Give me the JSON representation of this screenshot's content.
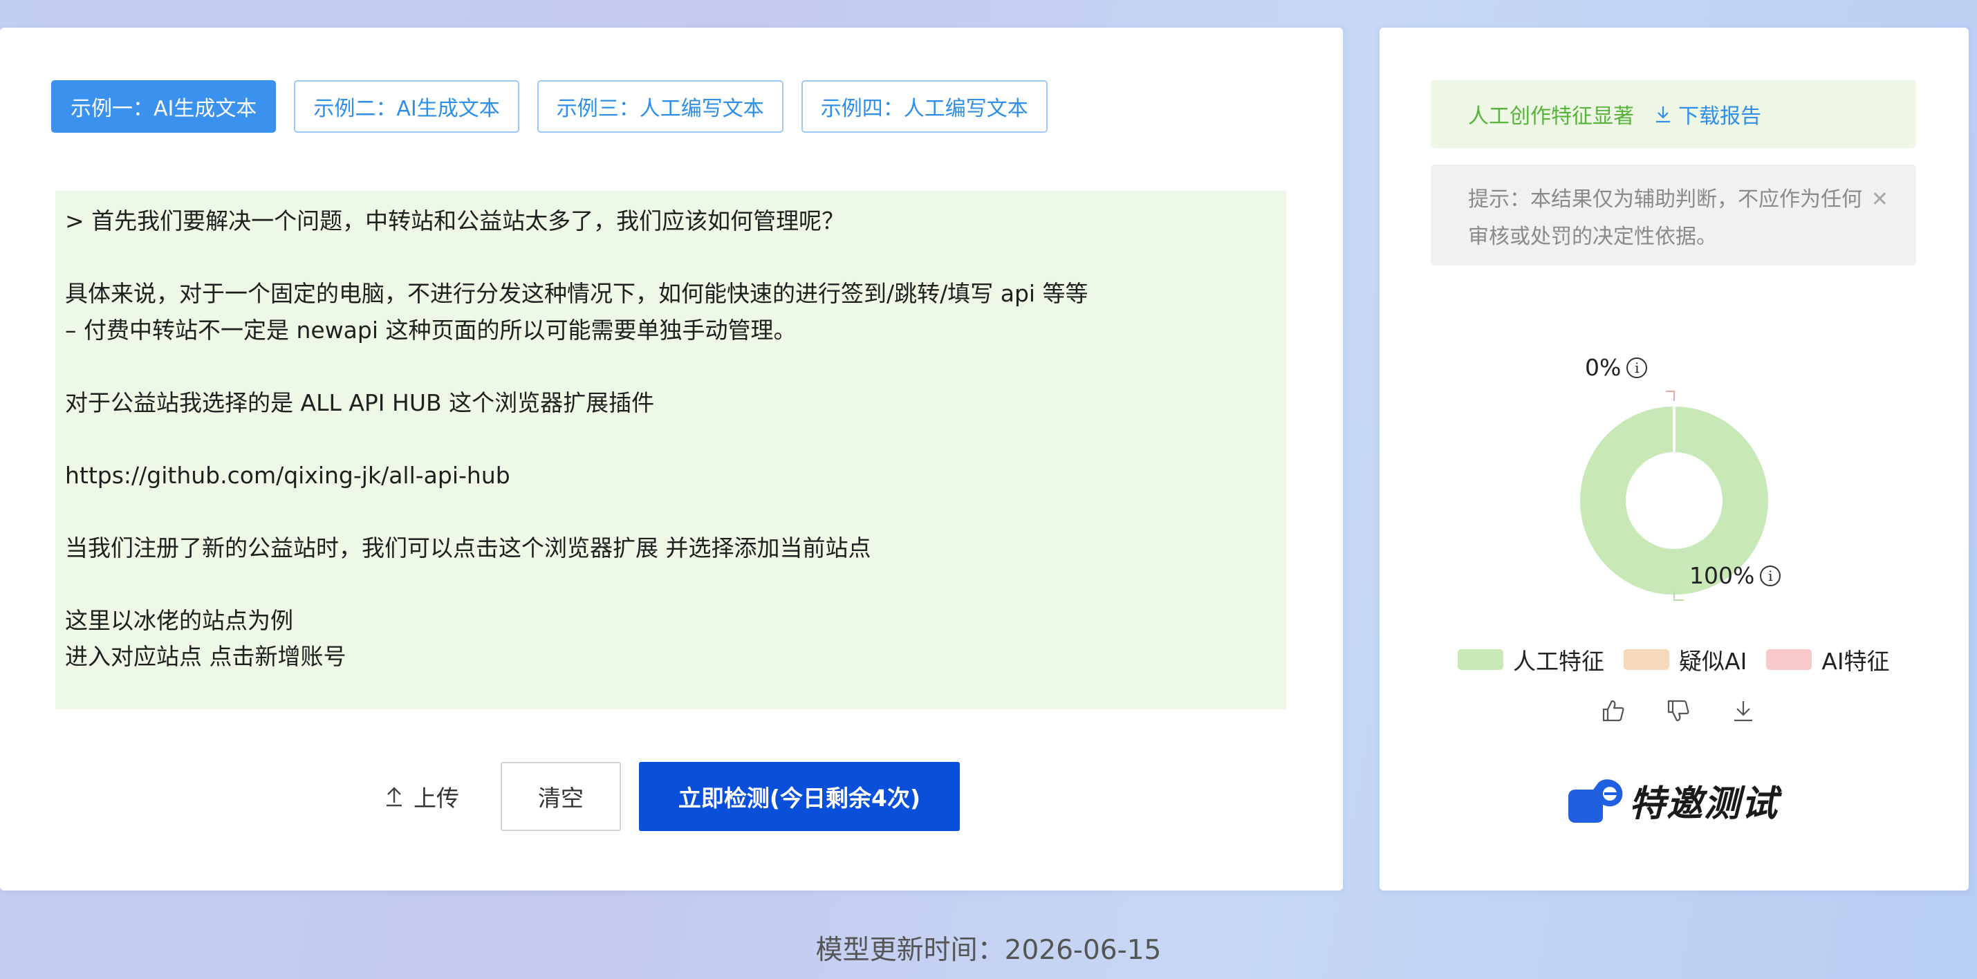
{
  "tabs": [
    {
      "label": "示例一：AI生成文本",
      "active": true
    },
    {
      "label": "示例二：AI生成文本",
      "active": false
    },
    {
      "label": "示例三：人工编写文本",
      "active": false
    },
    {
      "label": "示例四：人工编写文本",
      "active": false
    }
  ],
  "input_text": "> 首先我们要解决一个问题，中转站和公益站太多了，我们应该如何管理呢？\n\n具体来说，对于一个固定的电脑，不进行分发这种情况下，如何能快速的进行签到/跳转/填写 api 等等\n– 付费中转站不一定是 newapi 这种页面的所以可能需要单独手动管理。\n\n对于公益站我选择的是 ALL API HUB 这个浏览器扩展插件\n\nhttps://github.com/qixing-jk/all-api-hub\n\n当我们注册了新的公益站时，我们可以点击这个浏览器扩展 并选择添加当前站点\n\n这里以冰佬的站点为例\n进入对应站点 点击新增账号",
  "actions": {
    "upload_label": "上传",
    "clear_label": "清空",
    "detect_label": "立即检测(今日剩余4次)"
  },
  "result": {
    "summary": "人工创作特征显著",
    "download_label": "下载报告",
    "tip": "提示：本结果仅为辅助判断，不应作为任何审核或处罚的决定性依据。"
  },
  "chart_data": {
    "type": "pie",
    "categories": [
      "人工特征",
      "疑似AI",
      "AI特征"
    ],
    "values": [
      100,
      0,
      0
    ],
    "labels": {
      "ai": "0%",
      "human": "100%"
    },
    "colors": {
      "人工特征": "#c9e8b8",
      "疑似AI": "#f6d9b8",
      "AI特征": "#f8c9c9"
    }
  },
  "legend": [
    {
      "label": "人工特征",
      "color": "#c9e8b8"
    },
    {
      "label": "疑似AI",
      "color": "#f6d9b8"
    },
    {
      "label": "AI特征",
      "color": "#f8c9c9"
    }
  ],
  "promo": {
    "label": "特邀测试"
  },
  "footer": {
    "text": "模型更新时间：2026-06-15"
  },
  "icons": [
    "upload-icon",
    "download-icon",
    "close-icon",
    "info-icon",
    "thumbs-up-icon",
    "thumbs-down-icon",
    "pointing-hand-icon"
  ]
}
